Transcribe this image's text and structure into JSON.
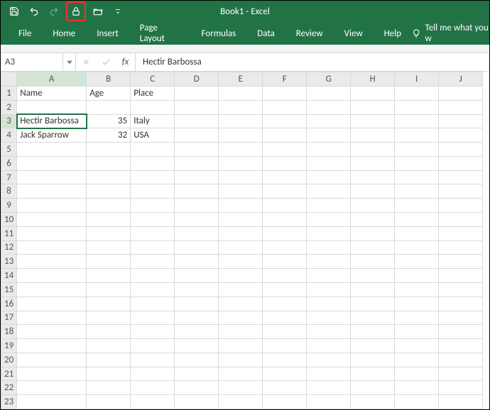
{
  "app": {
    "title": "Book1  -  Excel"
  },
  "qat": {
    "save": "save-icon",
    "undo": "undo-icon",
    "redo": "redo-icon",
    "protect": "lock-icon",
    "open": "folder-open-icon",
    "more": "chevron-down-icon"
  },
  "ribbon": {
    "tabs": [
      "File",
      "Home",
      "Insert",
      "Page Layout",
      "Formulas",
      "Data",
      "Review",
      "View",
      "Help"
    ],
    "tell_me": "Tell me what you w"
  },
  "formula_bar": {
    "name_box": "A3",
    "fx": "fx",
    "value": "Hectir Barbossa"
  },
  "grid": {
    "active_cell": "A3",
    "columns": [
      "A",
      "B",
      "C",
      "D",
      "E",
      "F",
      "G",
      "H",
      "I",
      "J"
    ],
    "row_count": 23,
    "data": {
      "A1": "Name",
      "B1": "Age",
      "C1": "Place",
      "A3": "Hectir Barbossa",
      "B3": "35",
      "C3": "Italy",
      "A4": "Jack Sparrow",
      "B4": "32",
      "C4": "USA"
    }
  }
}
